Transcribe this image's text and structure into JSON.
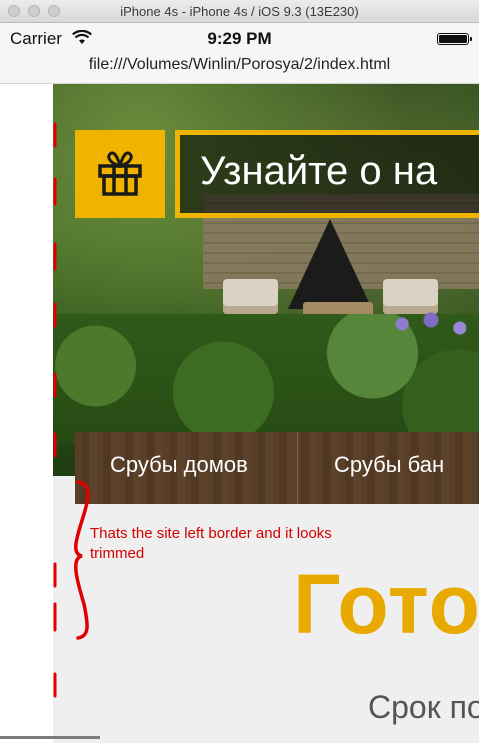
{
  "window": {
    "title": "iPhone 4s - iPhone 4s / iOS 9.3 (13E230)"
  },
  "status_bar": {
    "carrier": "Carrier",
    "time": "9:29 PM"
  },
  "browser": {
    "url": "file:///Volumes/Winlin/Porosya/2/index.html"
  },
  "site": {
    "promo_text": "Узнайте о на",
    "nav": [
      "Срубы домов",
      "Срубы бан"
    ],
    "heading": "Готов",
    "subheading": "Срок по"
  },
  "annotation": {
    "text": "Thats the site left border and it looks trimmed",
    "color": "#d40000"
  },
  "colors": {
    "accent": "#f0b400",
    "heading": "#e8a900"
  },
  "icons": {
    "gift": "gift-icon",
    "wifi": "wifi-icon",
    "battery": "battery-icon"
  }
}
